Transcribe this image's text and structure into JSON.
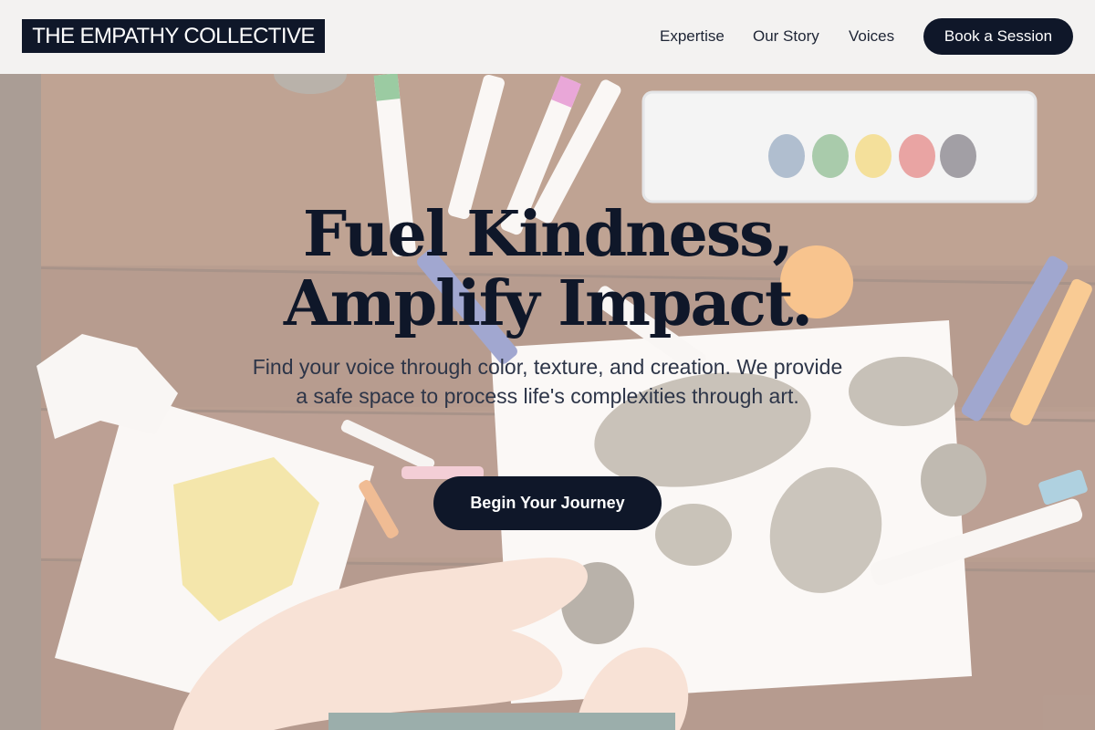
{
  "brand": {
    "logo_text": "THE EMPATHY COLLECTIVE"
  },
  "nav": {
    "items": [
      {
        "label": "Expertise"
      },
      {
        "label": "Our Story"
      },
      {
        "label": "Voices"
      }
    ],
    "cta_label": "Book a Session"
  },
  "hero": {
    "headline_line1": "Fuel Kindness,",
    "headline_line2": "Amplify Impact.",
    "subtitle": "Find your voice through color, texture, and creation. We provide a safe space to process life's complexities through art.",
    "cta_label": "Begin Your Journey",
    "background_image": "art-supplies-table-photo"
  },
  "colors": {
    "navy": "#0f1729",
    "header_bg": "#f3f2f1",
    "wood": "#6b3a22"
  }
}
